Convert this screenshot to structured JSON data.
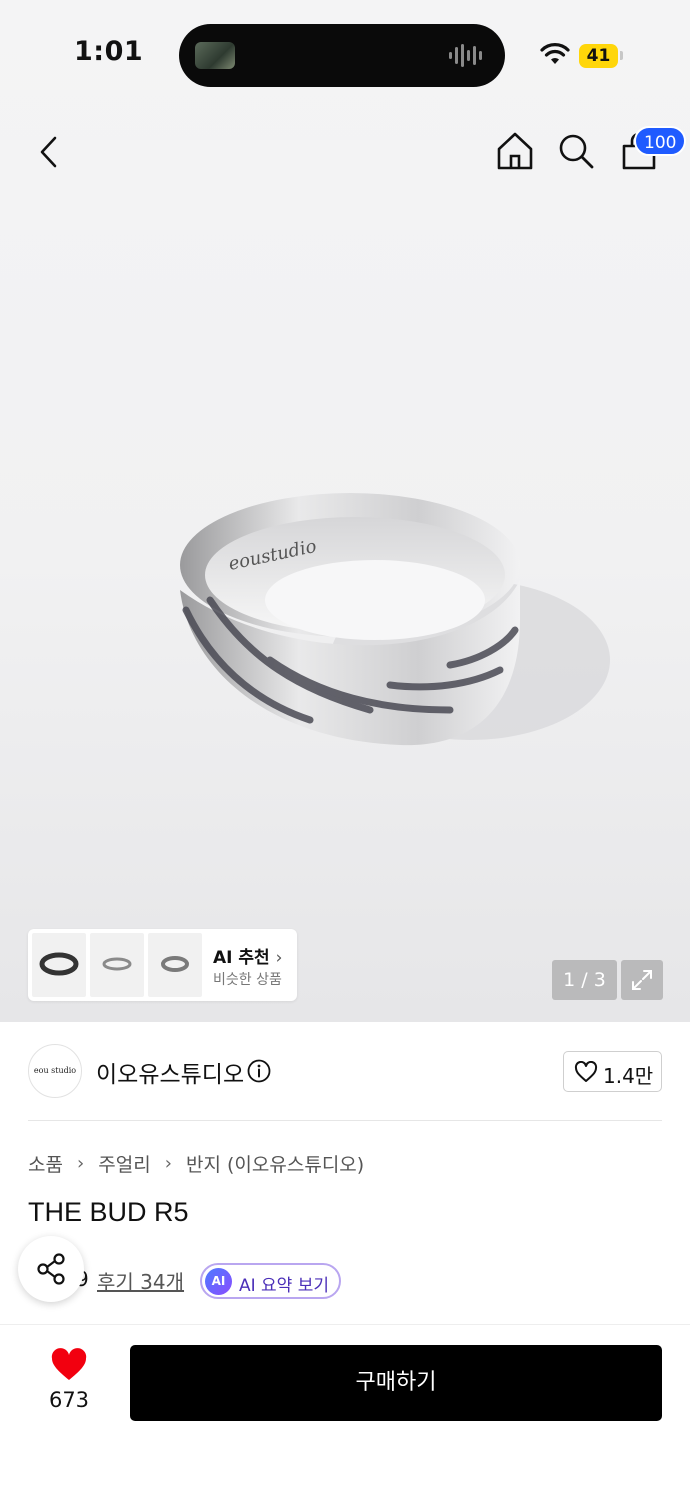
{
  "status_bar": {
    "time": "1:01",
    "battery": "41"
  },
  "header": {
    "cart_count": "100"
  },
  "gallery": {
    "counter": "1 / 3",
    "ai_recommend_title": "AI 추천",
    "ai_recommend_subtitle": "비슷한 상품"
  },
  "store": {
    "logo_text": "eou studio",
    "name": "이오유스튜디오",
    "like_count": "1.4만"
  },
  "product": {
    "breadcrumb": [
      "소품",
      "주얼리",
      "반지 (이오유스튜디오)"
    ],
    "title": "THE BUD R5",
    "rating_partial": "9",
    "review_link": "후기 34개",
    "ai_summary_badge": "AI",
    "ai_summary_label": "AI 요약 보기"
  },
  "bottom_bar": {
    "wish_count": "673",
    "buy_label": "구매하기"
  },
  "colors": {
    "badge": "#1f5bff",
    "heart": "#f2000f",
    "buy_button": "#000000",
    "ai_accent": "#4b2fb8"
  }
}
